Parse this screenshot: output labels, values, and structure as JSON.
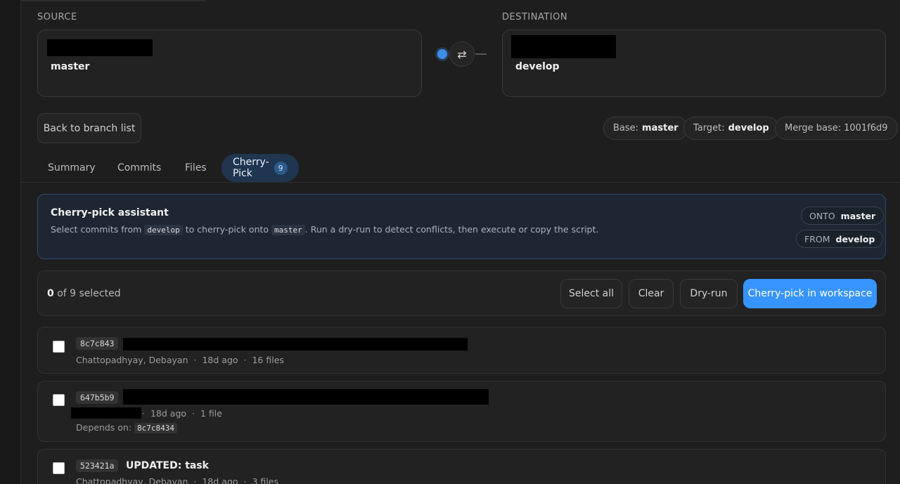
{
  "source": {
    "label": "SOURCE",
    "branch": "master"
  },
  "destination": {
    "label": "DESTINATION",
    "branch": "develop"
  },
  "back_button": "Back to branch list",
  "info": {
    "base_label": "Base:",
    "base_value": "master",
    "target_label": "Target:",
    "target_value": "develop",
    "merge_base_label": "Merge base:",
    "merge_base_value": "1001f6d9"
  },
  "tabs": [
    {
      "label": "Summary"
    },
    {
      "label": "Commits"
    },
    {
      "label": "Files"
    },
    {
      "label": "Cherry-Pick",
      "badge": "9"
    }
  ],
  "assistant": {
    "title": "Cherry-pick assistant",
    "desc_1": "Select commits from",
    "desc_code_1": "develop",
    "desc_2": "to cherry-pick onto",
    "desc_code_2": "master",
    "desc_3": ". Run a dry-run to detect conflicts, then execute or copy the script.",
    "onto_label": "ONTO",
    "onto_value": "master",
    "from_label": "FROM",
    "from_value": "develop"
  },
  "selection": {
    "count": "0",
    "of_text": "of 9 selected",
    "select_all": "Select all",
    "clear": "Clear",
    "dry_run": "Dry-run",
    "execute": "Cherry-pick in workspace"
  },
  "commits": [
    {
      "sha": "8c7c843",
      "title": "",
      "author": "Chattopadhyay, Debayan",
      "age": "18d ago",
      "files": "16 files"
    },
    {
      "sha": "647b5b9",
      "title": "",
      "author": "",
      "age": "18d ago",
      "files": "1 file",
      "depends_label": "Depends on:",
      "depends_sha": "8c7c8434"
    },
    {
      "sha": "523421a",
      "title": "UPDATED: task",
      "author": "Chattopadhyay, Debayan",
      "age": "18d ago",
      "files": "3 files"
    }
  ],
  "meta_separator": "·",
  "colors": {
    "accent": "#3794ff",
    "background": "#1e1e1e",
    "tab_active_bg": "#1f3550",
    "assistant_border": "#2d4a68"
  },
  "icons": {
    "swap": "swap-arrows-icon",
    "branch_dot": "branch-dot-icon"
  }
}
